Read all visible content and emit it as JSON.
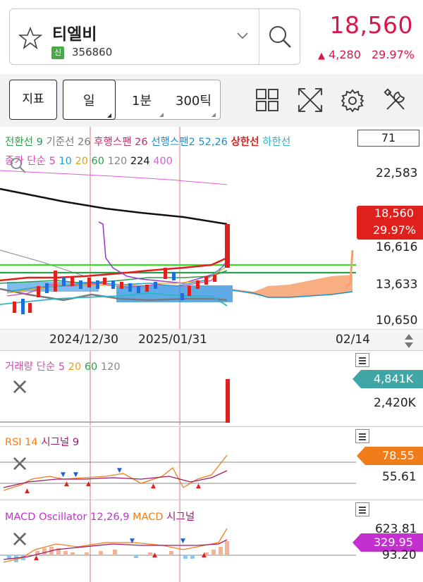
{
  "header": {
    "stock_name": "티엘비",
    "market_badge": "신",
    "stock_code": "356860",
    "price": "18,560",
    "change_arrow": "▲",
    "change_amount": "4,280",
    "change_percent": "29.97%",
    "icons": [
      "star-icon",
      "chevron-down-icon",
      "search-icon"
    ]
  },
  "toolbar": {
    "indicator_label": "지표",
    "period_day": "일",
    "period_minute": "1분",
    "period_tick": "300틱",
    "icons": [
      "grid-layout-icon",
      "expand-icon",
      "settings-gear-icon",
      "tools-icon"
    ]
  },
  "price_pane": {
    "ichimoku_legend": {
      "conversion": "전환선 9",
      "base": "기준선 26",
      "lagging": "후행스팬 26",
      "leading2": "선행스팬2 52,26",
      "upper_limit": "상한선",
      "lower_limit": "하한선"
    },
    "ma_legend": {
      "prefix": "종가 단순",
      "periods": [
        "5",
        "10",
        "20",
        "60",
        "120",
        "224",
        "400"
      ]
    },
    "counter_box": "71",
    "y_ticks": [
      "22,583",
      "16,616",
      "13,633",
      "10,650"
    ],
    "current_price_tag": "18,560",
    "current_pct_tag": "29.97%",
    "x_dates": [
      "2024/12/30",
      "2025/01/31",
      "02/14"
    ]
  },
  "volume_pane": {
    "legend_prefix": "거래량 단순",
    "periods": [
      "5",
      "20",
      "60",
      "120"
    ],
    "current_tag": "4,841K",
    "tick": "2,420K"
  },
  "rsi_pane": {
    "legend_rsi": "RSI 14",
    "legend_signal": "시그널 9",
    "current_tag": "78.55",
    "tick": "55.61"
  },
  "macd_pane": {
    "legend_osc": "MACD Oscillator 12,26,9",
    "legend_macd": "MACD",
    "legend_signal": "시그널",
    "current_tag": "329.95",
    "tick_top": "623.81",
    "tick_bottom": "93.20"
  },
  "colors": {
    "up": "#d8184b",
    "conversion": "#2aa04a",
    "base": "#7a7a7a",
    "lagging": "#c8286e",
    "leading2": "#1a8fcf",
    "upper_limit": "#e0201c",
    "lower_limit": "#2bb6c8",
    "ma5": "#d64cb4",
    "ma10": "#1d9fd8",
    "ma20": "#e9a20c",
    "ma60": "#2aa04a",
    "ma120": "#888888",
    "ma224": "#111111",
    "ma400": "#e55ad8",
    "volume_tag": "#3fa5a5",
    "rsi_tag": "#f07d1a",
    "macd_tag": "#c42fd0"
  }
}
